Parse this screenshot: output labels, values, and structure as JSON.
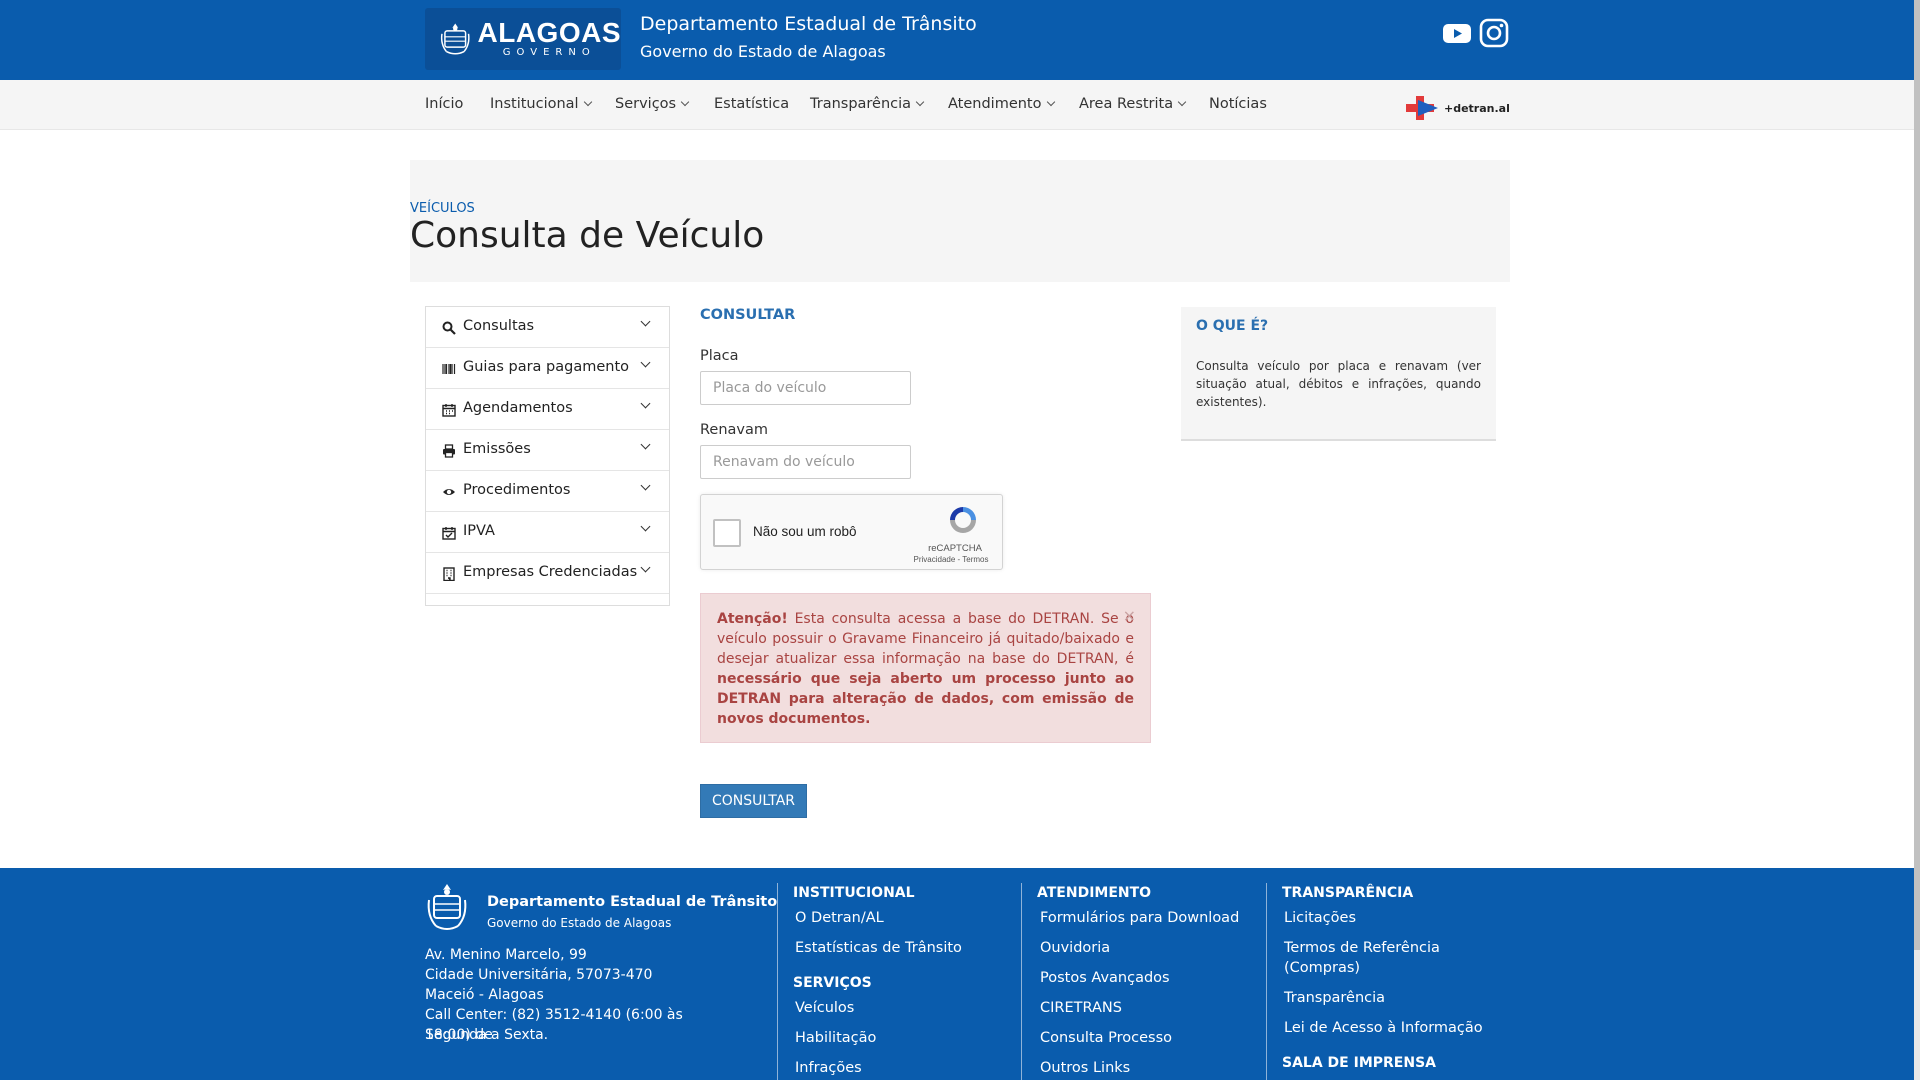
{
  "header": {
    "logo_text": "ALAGOAS",
    "logo_sub": "GOVERNO",
    "title": "Departamento Estadual de Trânsito",
    "subtitle": "Governo do Estado de Alagoas"
  },
  "nav": {
    "items": [
      {
        "label": "Início"
      },
      {
        "label": "Institucional"
      },
      {
        "label": "Serviços"
      },
      {
        "label": "Estatística"
      },
      {
        "label": "Transparência"
      },
      {
        "label": "Atendimento"
      },
      {
        "label": "Area Restrita"
      },
      {
        "label": "Notícias"
      }
    ],
    "app_logo_text": "+detran.al"
  },
  "page": {
    "breadcrumb": "VEÍCULOS",
    "title": "Consulta de Veículo"
  },
  "sidebar": {
    "items": [
      {
        "label": "Consultas",
        "icon": "search-icon"
      },
      {
        "label": "Guias para pagamento",
        "icon": "barcode-icon"
      },
      {
        "label": "Agendamentos",
        "icon": "calendar-icon"
      },
      {
        "label": "Emissões",
        "icon": "printer-icon"
      },
      {
        "label": "Procedimentos",
        "icon": "eye-icon"
      },
      {
        "label": "IPVA",
        "icon": "calendar-check-icon"
      },
      {
        "label": "Empresas Credenciadas",
        "icon": "building-icon"
      }
    ]
  },
  "form": {
    "heading": "CONSULTAR",
    "placa_label": "Placa",
    "placa_placeholder": "Placa do veículo",
    "renavam_label": "Renavam",
    "renavam_placeholder": "Renavam do veículo",
    "captcha_label": "Não sou um robô",
    "captcha_brand": "reCAPTCHA",
    "captcha_terms": "Privacidade - Termos",
    "alert_strong": "Atenção!",
    "alert_text": " Esta consulta acessa a base do DETRAN. Se o veículo possuir o Gravame Financeiro já quitado/baixado e desejar atualizar essa informação na base do DETRAN, é ",
    "alert_bold": "necessário que seja aberto um processo junto ao DETRAN para alteração de dados, com emissão de novos documentos.",
    "alert_close": "×",
    "submit_label": "CONSULTAR"
  },
  "info": {
    "title": "O QUE É?",
    "text": "Consulta veículo por placa e renavam (ver situação atual, débitos e infrações, quando existentes)."
  },
  "footer": {
    "name": "Departamento Estadual de Trânsito",
    "sub": "Governo do Estado de Alagoas",
    "address": [
      "Av. Menino Marcelo, 99",
      "Cidade Universitária, 57073-470",
      "Maceió - Alagoas",
      "Call Center: (82) 3512-4140 (6:00 às 18:00) de",
      "Segunda a Sexta."
    ],
    "institucional_head": "INSTITUCIONAL",
    "institucional": [
      "O Detran/AL",
      "Estatísticas de Trânsito"
    ],
    "servicos_head": "SERVIÇOS",
    "servicos": [
      "Veículos",
      "Habilitação",
      "Infrações"
    ],
    "atendimento_head": "ATENDIMENTO",
    "atendimento": [
      "Formulários para Download",
      "Ouvidoria",
      "Postos Avançados",
      "CIRETRANS",
      "Consulta Processo",
      "Outros Links"
    ],
    "transparencia_head": "TRANSPARÊNCIA",
    "transparencia": [
      "Licitações",
      "Termos de Referência",
      "(Compras)",
      "Transparência",
      "Lei de Acesso à Informação"
    ],
    "imprensa_head": "SALA DE IMPRENSA"
  },
  "colors": {
    "brand_blue": "#0a5cad",
    "alert_bg": "#f2dede",
    "alert_text": "#a94442",
    "button": "#337ab7"
  }
}
